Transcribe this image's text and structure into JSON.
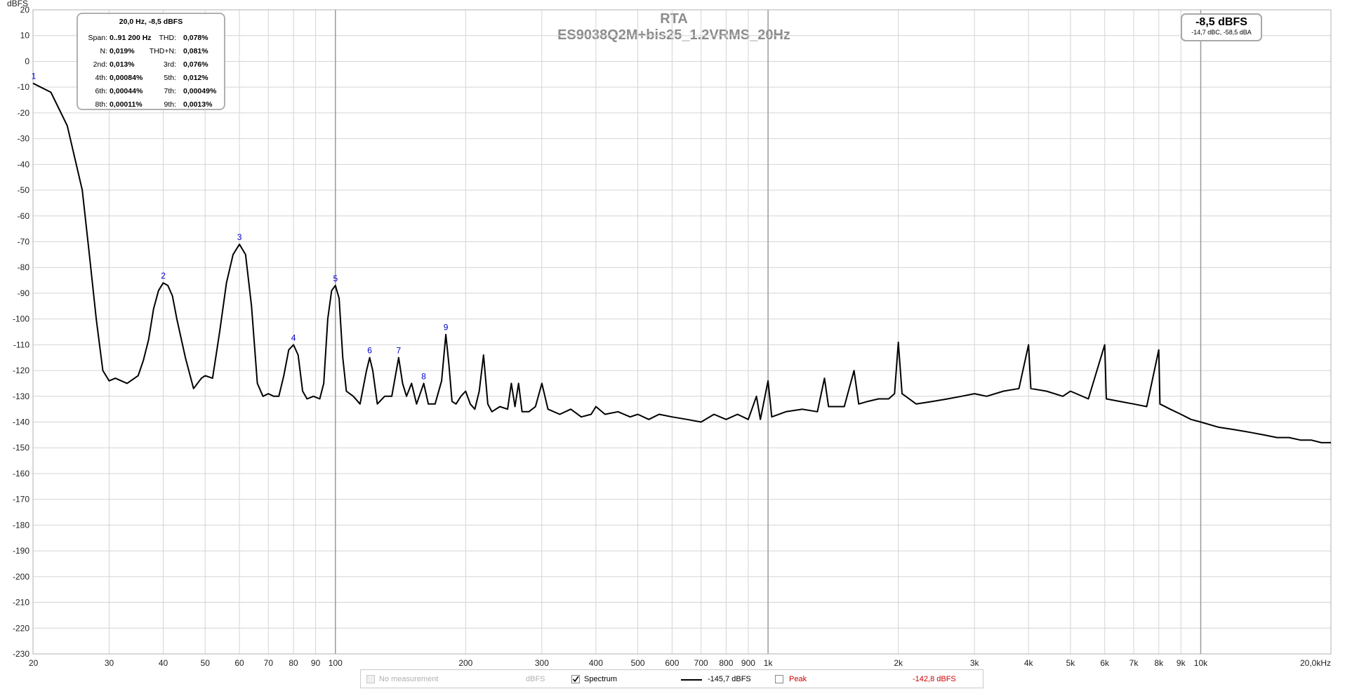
{
  "chart_data": {
    "type": "line",
    "title": "RTA",
    "subtitle": "ES9038Q2M+bis25_1.2VRMS_20Hz",
    "ylabel": "dBFS",
    "xscale": "log",
    "xlim": [
      20,
      20000
    ],
    "ylim": [
      -230,
      20
    ],
    "grid": true,
    "x_ticks": [
      {
        "v": 20,
        "label": "20"
      },
      {
        "v": 30,
        "label": "30"
      },
      {
        "v": 40,
        "label": "40"
      },
      {
        "v": 50,
        "label": "50"
      },
      {
        "v": 60,
        "label": "60"
      },
      {
        "v": 70,
        "label": "70"
      },
      {
        "v": 80,
        "label": "80"
      },
      {
        "v": 90,
        "label": "90"
      },
      {
        "v": 100,
        "label": "100"
      },
      {
        "v": 200,
        "label": "200"
      },
      {
        "v": 300,
        "label": "300"
      },
      {
        "v": 400,
        "label": "400"
      },
      {
        "v": 500,
        "label": "500"
      },
      {
        "v": 600,
        "label": "600"
      },
      {
        "v": 700,
        "label": "700"
      },
      {
        "v": 800,
        "label": "800"
      },
      {
        "v": 900,
        "label": "900"
      },
      {
        "v": 1000,
        "label": "1k"
      },
      {
        "v": 2000,
        "label": "2k"
      },
      {
        "v": 3000,
        "label": "3k"
      },
      {
        "v": 4000,
        "label": "4k"
      },
      {
        "v": 5000,
        "label": "5k"
      },
      {
        "v": 6000,
        "label": "6k"
      },
      {
        "v": 7000,
        "label": "7k"
      },
      {
        "v": 8000,
        "label": "8k"
      },
      {
        "v": 9000,
        "label": "9k"
      },
      {
        "v": 10000,
        "label": "10k"
      },
      {
        "v": 20000,
        "label": "20,0kHz"
      }
    ],
    "y_ticks": [
      20,
      10,
      0,
      -10,
      -20,
      -30,
      -40,
      -50,
      -60,
      -70,
      -80,
      -90,
      -100,
      -110,
      -120,
      -130,
      -140,
      -150,
      -160,
      -170,
      -180,
      -190,
      -200,
      -210,
      -220,
      -230
    ],
    "harmonic_markers": [
      {
        "label": "1",
        "x": 20,
        "y": -8.5
      },
      {
        "label": "2",
        "x": 40,
        "y": -86
      },
      {
        "label": "3",
        "x": 60,
        "y": -71
      },
      {
        "label": "4",
        "x": 80,
        "y": -110
      },
      {
        "label": "5",
        "x": 100,
        "y": -87
      },
      {
        "label": "6",
        "x": 120,
        "y": -115
      },
      {
        "label": "7",
        "x": 140,
        "y": -115
      },
      {
        "label": "8",
        "x": 160,
        "y": -125
      },
      {
        "label": "9",
        "x": 180,
        "y": -106
      }
    ],
    "series": [
      {
        "name": "Spectrum",
        "color": "#000000",
        "points": [
          [
            20,
            -8.5
          ],
          [
            22,
            -12
          ],
          [
            24,
            -25
          ],
          [
            26,
            -50
          ],
          [
            27,
            -75
          ],
          [
            28,
            -100
          ],
          [
            29,
            -120
          ],
          [
            30,
            -124
          ],
          [
            31,
            -123
          ],
          [
            33,
            -125
          ],
          [
            35,
            -122
          ],
          [
            36,
            -116
          ],
          [
            37,
            -108
          ],
          [
            38,
            -96
          ],
          [
            39,
            -89
          ],
          [
            40,
            -86
          ],
          [
            41,
            -87
          ],
          [
            42,
            -91
          ],
          [
            43,
            -100
          ],
          [
            45,
            -115
          ],
          [
            47,
            -127
          ],
          [
            49,
            -123
          ],
          [
            50,
            -122
          ],
          [
            52,
            -123
          ],
          [
            54,
            -105
          ],
          [
            56,
            -86
          ],
          [
            58,
            -75
          ],
          [
            60,
            -71
          ],
          [
            62,
            -75
          ],
          [
            64,
            -95
          ],
          [
            66,
            -125
          ],
          [
            68,
            -130
          ],
          [
            70,
            -129
          ],
          [
            72,
            -130
          ],
          [
            74,
            -130
          ],
          [
            76,
            -122
          ],
          [
            78,
            -112
          ],
          [
            80,
            -110
          ],
          [
            82,
            -114
          ],
          [
            84,
            -128
          ],
          [
            86,
            -131
          ],
          [
            89,
            -130
          ],
          [
            92,
            -131
          ],
          [
            94,
            -125
          ],
          [
            96,
            -100
          ],
          [
            98,
            -89
          ],
          [
            100,
            -87
          ],
          [
            102,
            -92
          ],
          [
            104,
            -115
          ],
          [
            106,
            -128
          ],
          [
            110,
            -130
          ],
          [
            114,
            -133
          ],
          [
            118,
            -120
          ],
          [
            120,
            -115
          ],
          [
            122,
            -120
          ],
          [
            125,
            -133
          ],
          [
            130,
            -130
          ],
          [
            135,
            -130
          ],
          [
            140,
            -115
          ],
          [
            143,
            -125
          ],
          [
            146,
            -130
          ],
          [
            150,
            -125
          ],
          [
            154,
            -133
          ],
          [
            160,
            -125
          ],
          [
            164,
            -133
          ],
          [
            170,
            -133
          ],
          [
            176,
            -124
          ],
          [
            180,
            -106
          ],
          [
            183,
            -118
          ],
          [
            186,
            -132
          ],
          [
            190,
            -133
          ],
          [
            195,
            -130
          ],
          [
            200,
            -128
          ],
          [
            205,
            -133
          ],
          [
            210,
            -135
          ],
          [
            215,
            -128
          ],
          [
            220,
            -114
          ],
          [
            225,
            -133
          ],
          [
            230,
            -136
          ],
          [
            240,
            -134
          ],
          [
            250,
            -135
          ],
          [
            255,
            -125
          ],
          [
            260,
            -134
          ],
          [
            265,
            -125
          ],
          [
            270,
            -136
          ],
          [
            280,
            -136
          ],
          [
            290,
            -134
          ],
          [
            300,
            -125
          ],
          [
            310,
            -135
          ],
          [
            330,
            -137
          ],
          [
            350,
            -135
          ],
          [
            370,
            -138
          ],
          [
            390,
            -137
          ],
          [
            400,
            -134
          ],
          [
            420,
            -137
          ],
          [
            450,
            -136
          ],
          [
            480,
            -138
          ],
          [
            500,
            -137
          ],
          [
            530,
            -139
          ],
          [
            560,
            -137
          ],
          [
            600,
            -138
          ],
          [
            650,
            -139
          ],
          [
            700,
            -140
          ],
          [
            750,
            -137
          ],
          [
            800,
            -139
          ],
          [
            850,
            -137
          ],
          [
            900,
            -139
          ],
          [
            940,
            -130
          ],
          [
            960,
            -139
          ],
          [
            1000,
            -124
          ],
          [
            1020,
            -138
          ],
          [
            1100,
            -136
          ],
          [
            1200,
            -135
          ],
          [
            1300,
            -136
          ],
          [
            1350,
            -123
          ],
          [
            1380,
            -134
          ],
          [
            1500,
            -134
          ],
          [
            1580,
            -120
          ],
          [
            1620,
            -133
          ],
          [
            1700,
            -132
          ],
          [
            1800,
            -131
          ],
          [
            1900,
            -131
          ],
          [
            1960,
            -129
          ],
          [
            2000,
            -109
          ],
          [
            2040,
            -129
          ],
          [
            2200,
            -133
          ],
          [
            2400,
            -132
          ],
          [
            2600,
            -131
          ],
          [
            2800,
            -130
          ],
          [
            3000,
            -129
          ],
          [
            3200,
            -130
          ],
          [
            3500,
            -128
          ],
          [
            3800,
            -127
          ],
          [
            4000,
            -110
          ],
          [
            4050,
            -127
          ],
          [
            4400,
            -128
          ],
          [
            4800,
            -130
          ],
          [
            5000,
            -128
          ],
          [
            5500,
            -131
          ],
          [
            6000,
            -110
          ],
          [
            6050,
            -131
          ],
          [
            6500,
            -132
          ],
          [
            7000,
            -133
          ],
          [
            7500,
            -134
          ],
          [
            8000,
            -112
          ],
          [
            8050,
            -133
          ],
          [
            8500,
            -135
          ],
          [
            9000,
            -137
          ],
          [
            9500,
            -139
          ],
          [
            10000,
            -140
          ],
          [
            11000,
            -142
          ],
          [
            12000,
            -143
          ],
          [
            13000,
            -144
          ],
          [
            14000,
            -145
          ],
          [
            15000,
            -146
          ],
          [
            16000,
            -146
          ],
          [
            17000,
            -147
          ],
          [
            18000,
            -147
          ],
          [
            19000,
            -148
          ],
          [
            20000,
            -148
          ]
        ]
      }
    ]
  },
  "info_box": {
    "title": "20,0 Hz, -8,5 dBFS",
    "rows": [
      {
        "l1": "Span:",
        "v1": "0..91 200 Hz",
        "l2": "THD:",
        "v2": "0,078%"
      },
      {
        "l1": "N:",
        "v1": "0,019%",
        "l2": "THD+N:",
        "v2": "0,081%"
      },
      {
        "l1": "2nd:",
        "v1": "0,013%",
        "l2": "3rd:",
        "v2": "0,076%"
      },
      {
        "l1": "4th:",
        "v1": "0,00084%",
        "l2": "5th:",
        "v2": "0,012%"
      },
      {
        "l1": "6th:",
        "v1": "0,00044%",
        "l2": "7th:",
        "v2": "0,00049%"
      },
      {
        "l1": "8th:",
        "v1": "0,00011%",
        "l2": "9th:",
        "v2": "0,0013%"
      }
    ]
  },
  "level_box": {
    "main": "-8,5 dBFS",
    "sub": "-14,7 dBC, -58,5 dBA"
  },
  "legend": {
    "no_measurement": "No measurement",
    "unit": "dBFS",
    "spectrum_label": "Spectrum",
    "spectrum_value": "-145,7 dBFS",
    "peak_label": "Peak",
    "peak_value": "-142,8 dBFS",
    "spectrum_checked": true,
    "peak_checked": false,
    "peak_color": "#cc0000"
  }
}
